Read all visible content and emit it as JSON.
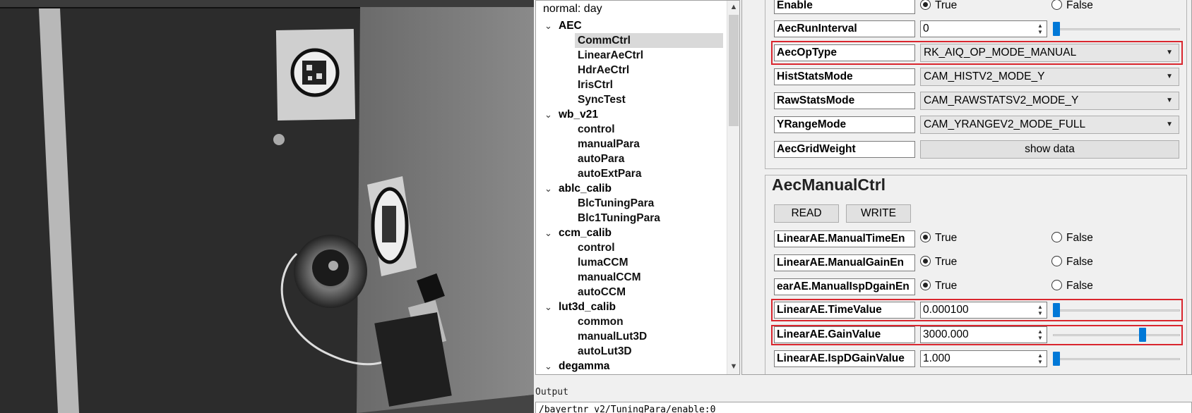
{
  "tree": {
    "header": "normal: day",
    "rows": [
      {
        "type": "group",
        "label": "AEC"
      },
      {
        "type": "child",
        "label": "CommCtrl",
        "selected": true
      },
      {
        "type": "child",
        "label": "LinearAeCtrl"
      },
      {
        "type": "child",
        "label": "HdrAeCtrl"
      },
      {
        "type": "child",
        "label": "IrisCtrl"
      },
      {
        "type": "child",
        "label": "SyncTest"
      },
      {
        "type": "group",
        "label": "wb_v21"
      },
      {
        "type": "child",
        "label": "control"
      },
      {
        "type": "child",
        "label": "manualPara"
      },
      {
        "type": "child",
        "label": "autoPara"
      },
      {
        "type": "child",
        "label": "autoExtPara"
      },
      {
        "type": "group",
        "label": "ablc_calib"
      },
      {
        "type": "child",
        "label": "BlcTuningPara"
      },
      {
        "type": "child",
        "label": "Blc1TuningPara"
      },
      {
        "type": "group",
        "label": "ccm_calib"
      },
      {
        "type": "child",
        "label": "control"
      },
      {
        "type": "child",
        "label": "lumaCCM"
      },
      {
        "type": "child",
        "label": "manualCCM"
      },
      {
        "type": "child",
        "label": "autoCCM"
      },
      {
        "type": "group",
        "label": "lut3d_calib"
      },
      {
        "type": "child",
        "label": "common"
      },
      {
        "type": "child",
        "label": "manualLut3D"
      },
      {
        "type": "child",
        "label": "autoLut3D"
      },
      {
        "type": "group",
        "label": "degamma"
      }
    ]
  },
  "comm": {
    "enable": {
      "label": "Enable",
      "true": "True",
      "false": "False",
      "value": true
    },
    "run_interval": {
      "label": "AecRunInterval",
      "value": "0",
      "slider_fraction": 0.0
    },
    "op_type": {
      "label": "AecOpType",
      "value": "RK_AIQ_OP_MODE_MANUAL"
    },
    "hist_stats": {
      "label": "HistStatsMode",
      "value": "CAM_HISTV2_MODE_Y"
    },
    "raw_stats": {
      "label": "RawStatsMode",
      "value": "CAM_RAWSTATSV2_MODE_Y"
    },
    "yrange": {
      "label": "YRangeMode",
      "value": "CAM_YRANGEV2_MODE_FULL"
    },
    "grid_weight": {
      "label": "AecGridWeight",
      "button": "show data"
    }
  },
  "manual": {
    "title": "AecManualCtrl",
    "read": "READ",
    "write": "WRITE",
    "time_en": {
      "label": "LinearAE.ManualTimeEn",
      "true": "True",
      "false": "False",
      "value": true
    },
    "gain_en": {
      "label": "LinearAE.ManualGainEn",
      "true": "True",
      "false": "False",
      "value": true
    },
    "ispd_en": {
      "label": "earAE.ManualIspDgainEn",
      "true": "True",
      "false": "False",
      "value": true
    },
    "time_value": {
      "label": "LinearAE.TimeValue",
      "value": "0.000100",
      "slider_fraction": 0.0
    },
    "gain_value": {
      "label": "LinearAE.GainValue",
      "value": "3000.000",
      "slider_fraction": 0.72
    },
    "ispd_gain": {
      "label": "LinearAE.IspDGainValue",
      "value": "1.000",
      "slider_fraction": 0.0
    }
  },
  "output": {
    "title": "Output",
    "line": "/bayertnr_v2/TuningPara/enable:0"
  },
  "colors": {
    "highlight": "#d9262e",
    "slider": "#0078d7"
  }
}
